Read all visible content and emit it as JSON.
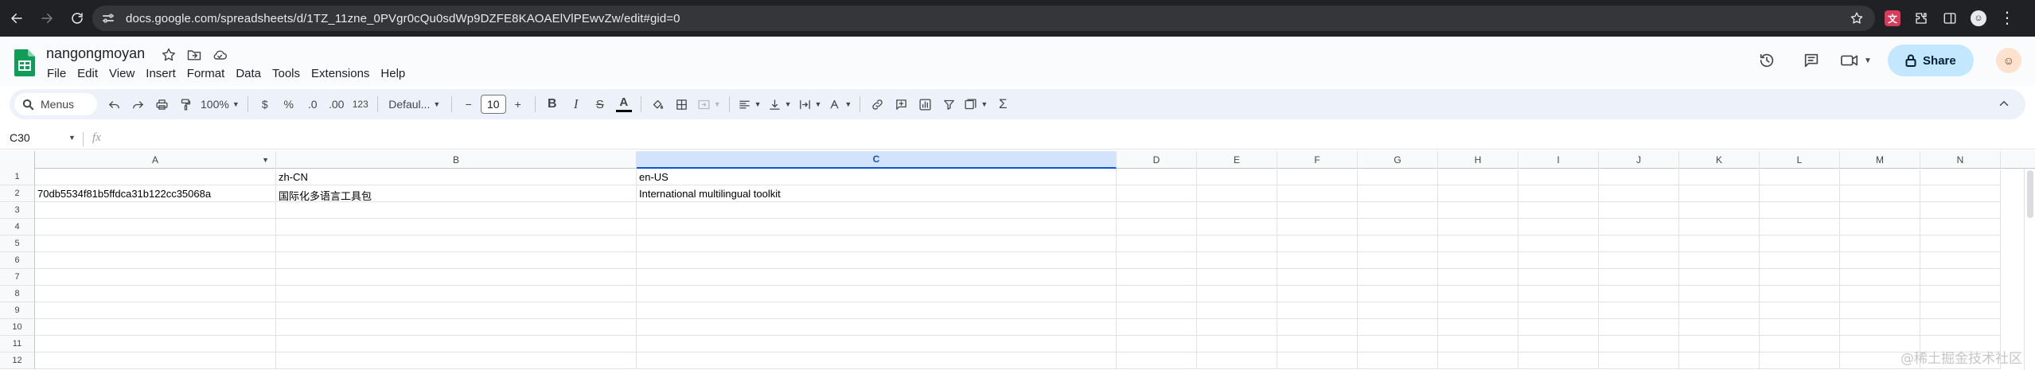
{
  "browser": {
    "url": "docs.google.com/spreadsheets/d/1TZ_11zne_0PVgr0cQu0sdWp9DZFE8KAOAElVlPEwvZw/edit#gid=0",
    "extension_translate_label": "文",
    "avatar_label": "☺"
  },
  "header": {
    "doc_title": "nangongmoyan",
    "menu": [
      "File",
      "Edit",
      "View",
      "Insert",
      "Format",
      "Data",
      "Tools",
      "Extensions",
      "Help"
    ],
    "share_label": "Share"
  },
  "toolbar": {
    "menus_label": "Menus",
    "zoom": "100%",
    "currency": "$",
    "percent": "%",
    "dec_decrease": ".0",
    "dec_increase": ".00",
    "number_format": "123",
    "font": "Defaul...",
    "font_size": "10",
    "minus": "−",
    "plus": "+",
    "bold": "B",
    "italic": "I",
    "strike": "S",
    "text_color_letter": "A",
    "function_symbol": "Σ"
  },
  "formula_bar": {
    "name_box": "C30",
    "fx": "fx"
  },
  "grid": {
    "selected_column": "C",
    "columns": [
      "A",
      "B",
      "C",
      "D",
      "E",
      "F",
      "G",
      "H",
      "I",
      "J",
      "K",
      "L",
      "M",
      "N"
    ],
    "row_numbers": [
      "1",
      "2",
      "3",
      "4",
      "5",
      "6",
      "7",
      "8",
      "9",
      "10",
      "11",
      "12"
    ],
    "rows": [
      [
        "",
        "zh-CN",
        "en-US"
      ],
      [
        "70db5534f81b5ffdca31b122cc35068a",
        "国际化多语言工具包",
        "International multilingual toolkit"
      ]
    ]
  },
  "watermark": "@稀土掘金技术社区",
  "colors": {
    "chrome_bg": "#202124",
    "toolbar_bg": "#edf2fa",
    "share_bg": "#c2e7ff",
    "selection": "#0b57d0",
    "sheets_green": "#0f9d58"
  }
}
